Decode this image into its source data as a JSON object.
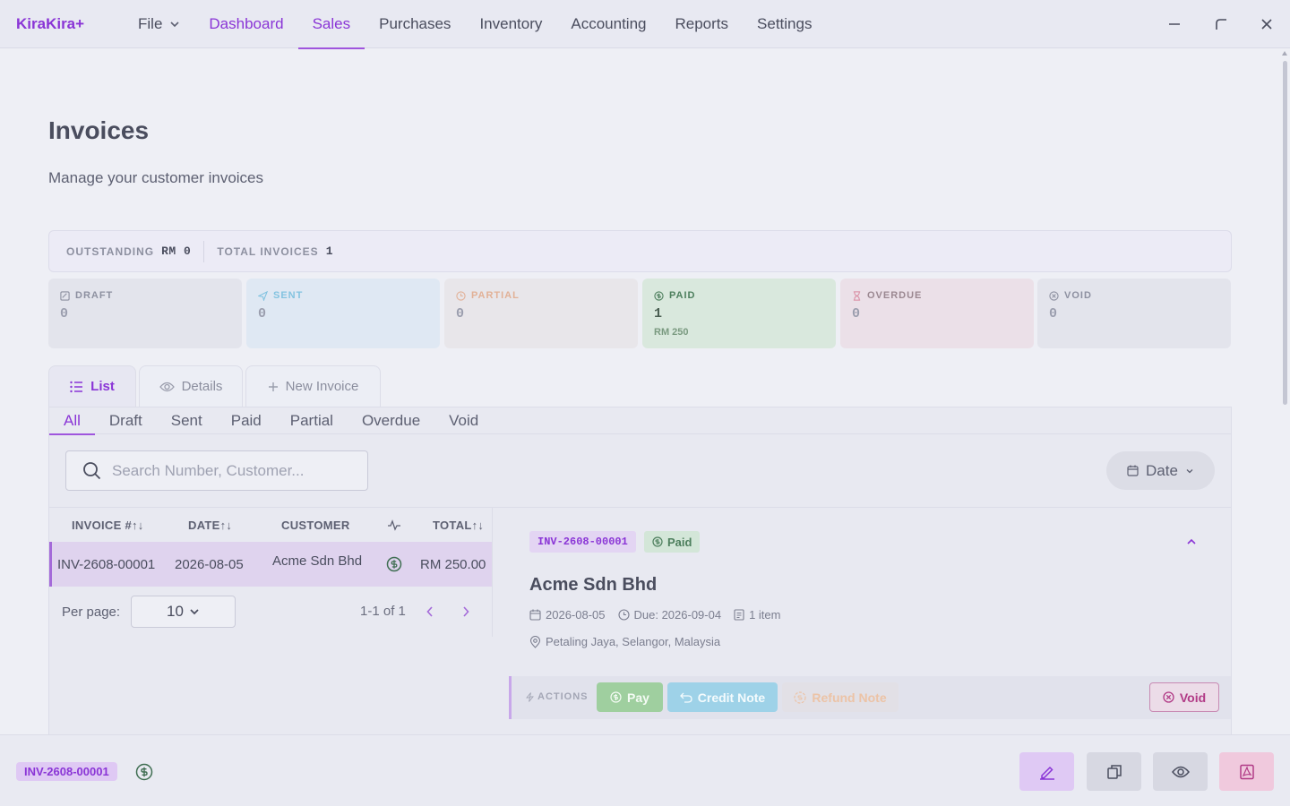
{
  "app": {
    "logo": "KiraKira+"
  },
  "nav": {
    "file": "File",
    "items": [
      "Dashboard",
      "Sales",
      "Purchases",
      "Inventory",
      "Accounting",
      "Reports",
      "Settings"
    ]
  },
  "header": {
    "title": "Invoices",
    "subtitle": "Manage your customer invoices"
  },
  "summary": {
    "outstanding_label": "OUTSTANDING",
    "outstanding_value": "RM 0",
    "total_label": "TOTAL INVOICES",
    "total_value": "1"
  },
  "status_cards": [
    {
      "label": "DRAFT",
      "count": "0",
      "amount": "",
      "icon": "draft-icon",
      "bg": "#e3e4ec",
      "color": "#8d90a0"
    },
    {
      "label": "SENT",
      "count": "0",
      "amount": "",
      "icon": "send-icon",
      "bg": "#dfe8f3",
      "color": "#83c3e0"
    },
    {
      "label": "PARTIAL",
      "count": "0",
      "amount": "",
      "icon": "clock-icon",
      "bg": "#e8e6ea",
      "color": "#e2b197"
    },
    {
      "label": "PAID",
      "count": "1",
      "amount": "RM 250",
      "icon": "dollar-circle-icon",
      "bg": "#d9e8dd",
      "color": "#4d7f5d"
    },
    {
      "label": "OVERDUE",
      "count": "0",
      "amount": "",
      "icon": "hourglass-icon",
      "bg": "#ebe0e8",
      "color": "#b4949f"
    },
    {
      "label": "VOID",
      "count": "0",
      "amount": "",
      "icon": "x-circle-icon",
      "bg": "#e3e4ec",
      "color": "#8d90a0"
    }
  ],
  "view_tabs": {
    "list": "List",
    "details": "Details",
    "new": "New Invoice"
  },
  "filter_tabs": [
    "All",
    "Draft",
    "Sent",
    "Paid",
    "Partial",
    "Overdue",
    "Void"
  ],
  "search": {
    "placeholder": "Search Number, Customer..."
  },
  "date_filter": "Date",
  "table": {
    "headers": {
      "number": "INVOICE #↑↓",
      "date": "DATE↑↓",
      "customer": "CUSTOMER",
      "total": "TOTAL↑↓"
    },
    "rows": [
      {
        "number": "INV-2608-00001",
        "date": "2026-08-05",
        "customer": "Acme Sdn Bhd",
        "total": "RM 250.00"
      }
    ]
  },
  "pagination": {
    "per_page_label": "Per page:",
    "per_page": "10",
    "range": "1-1 of 1"
  },
  "detail": {
    "number": "INV-2608-00001",
    "status": "Paid",
    "customer": "Acme Sdn Bhd",
    "date": "2026-08-05",
    "due": "Due: 2026-09-04",
    "items": "1 item",
    "location": "Petaling Jaya, Selangor, Malaysia",
    "actions_label": "ACTIONS",
    "pay": "Pay",
    "credit_note": "Credit Note",
    "refund_note": "Refund Note",
    "void": "Void"
  },
  "bottom": {
    "invoice": "INV-2608-00001"
  },
  "colors": {
    "accent": "#8a35d6",
    "paid": "#4d7f5d"
  }
}
